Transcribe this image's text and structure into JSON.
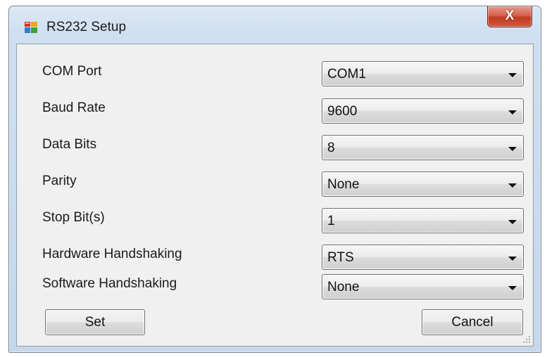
{
  "window": {
    "title": "RS232 Setup",
    "close_label": "X"
  },
  "fields": [
    {
      "label": "COM Port",
      "value": "COM1"
    },
    {
      "label": "Baud Rate",
      "value": "9600"
    },
    {
      "label": "Data Bits",
      "value": "8"
    },
    {
      "label": "Parity",
      "value": "None"
    },
    {
      "label": "Stop Bit(s)",
      "value": "1"
    },
    {
      "label": "Hardware Handshaking",
      "value": "RTS"
    },
    {
      "label": "Software Handshaking",
      "value": "None"
    }
  ],
  "buttons": {
    "set_label": "Set",
    "cancel_label": "Cancel"
  },
  "icons": {
    "app": "window-app-icon",
    "close": "close-icon",
    "dropdown": "chevron-down-icon",
    "resize": "resize-grip-icon"
  },
  "colors": {
    "title_bar": "#cfdff0",
    "close_button": "#c84a30",
    "client_background": "#f0f0f0"
  }
}
